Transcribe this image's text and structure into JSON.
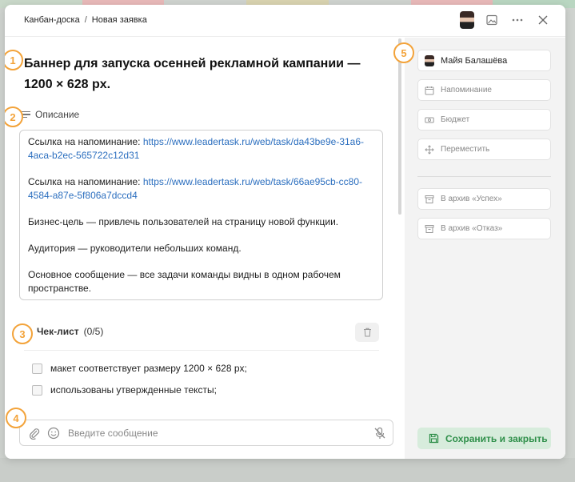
{
  "breadcrumb": {
    "root": "Канбан-доска",
    "separator": "/",
    "current": "Новая заявка"
  },
  "badges": [
    "1",
    "2",
    "3",
    "4",
    "5"
  ],
  "task": {
    "title": "Баннер для запуска осенней рекламной кампании — 1200 × 628 px."
  },
  "description": {
    "label": "Описание",
    "reminder_prefix_1": "Ссылка на напоминание:",
    "link_1": "https://www.leadertask.ru/web/task/da43be9e-31a6-4aca-b2ec-565722c12d31",
    "reminder_prefix_2": "Ссылка на напоминание:",
    "link_2": "https://www.leadertask.ru/web/task/66ae95cb-cc80-4584-a87e-5f806a7dccd4",
    "goal": "Бизнес-цель — привлечь пользователей на страницу новой функции.",
    "audience": "Аудитория — руководители небольших команд.",
    "message": "Основное сообщение — все задачи команды видны в одном рабочем пространстве."
  },
  "checklist": {
    "label": "Чек-лист",
    "count": "(0/5)",
    "items": [
      "макет соответствует размеру 1200 × 628 px;",
      "использованы утвержденные тексты;"
    ]
  },
  "composer": {
    "placeholder": "Введите сообщение"
  },
  "sidebar": {
    "assignee": "Майя Балашёва",
    "reminder": "Напоминание",
    "budget": "Бюджет",
    "move": "Переместить",
    "archive_success": "В архив «Успех»",
    "archive_fail": "В архив «Отказ»",
    "save_close": "Сохранить и закрыть"
  },
  "colors": {
    "badge": "#f3a33a",
    "link": "#2c6fbf",
    "save_bg": "#d7ecdc",
    "save_text": "#2f8f4a",
    "sidebar_bg": "#f3f3f3"
  }
}
